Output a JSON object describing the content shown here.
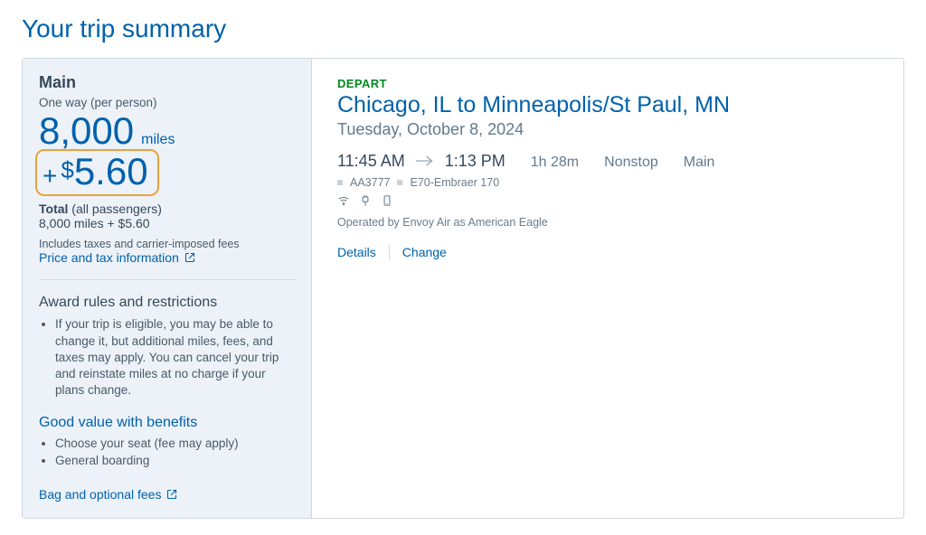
{
  "page": {
    "title": "Your trip summary"
  },
  "sidebar": {
    "fare_name": "Main",
    "fare_sub": "One way (per person)",
    "miles": "8,000",
    "miles_suffix": "miles",
    "cash_plus": "+",
    "cash_dollar": "$",
    "cash_amount": "5.60",
    "total_label": "Total",
    "total_qualifier": "(all passengers)",
    "total_value": "8,000 miles + $5.60",
    "includes_text": "Includes taxes and carrier-imposed fees",
    "price_tax_link": "Price and tax information",
    "rules_title": "Award rules and restrictions",
    "rules_text": "If your trip is eligible, you may be able to change it, but additional miles, fees, and taxes may apply. You can cancel your trip and reinstate miles at no charge if your plans change.",
    "benefits_title": "Good value with benefits",
    "benefits": [
      "Choose your seat (fee may apply)",
      "General boarding"
    ],
    "bag_fees_link": "Bag and optional fees"
  },
  "main": {
    "depart_label": "DEPART",
    "route": "Chicago, IL to Minneapolis/St Paul, MN",
    "date": "Tuesday, October 8, 2024",
    "dep_time": "11:45 AM",
    "arr_time": "1:13 PM",
    "duration": "1h 28m",
    "stops": "Nonstop",
    "cabin": "Main",
    "flight_no": "AA3777",
    "aircraft": "E70-Embraer 170",
    "operated_by": "Operated by Envoy Air as American Eagle",
    "details_link": "Details",
    "change_link": "Change"
  }
}
